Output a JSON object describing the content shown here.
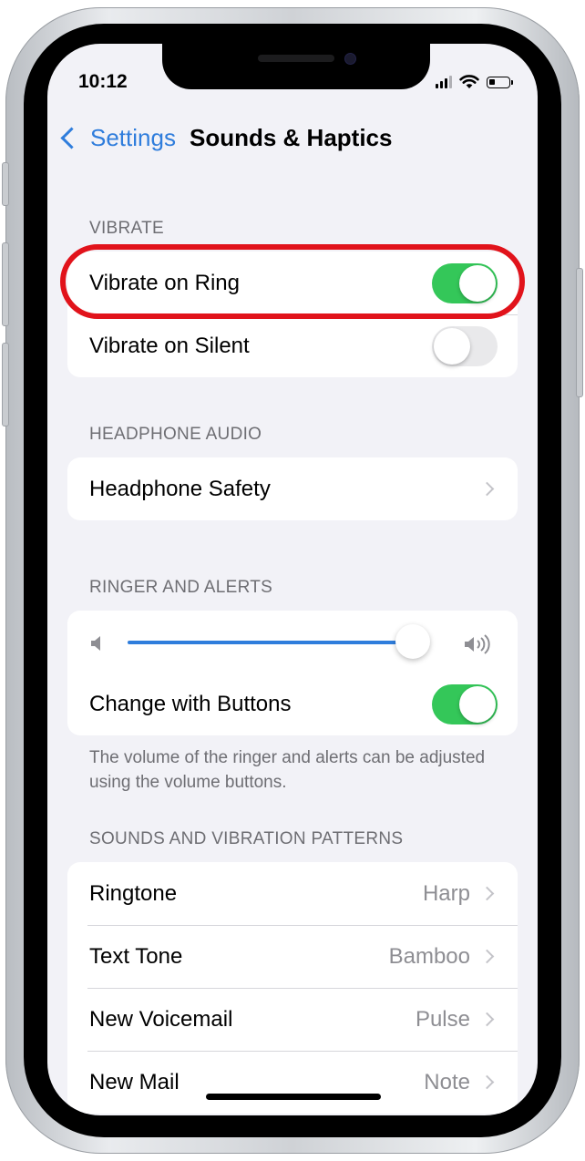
{
  "status_bar": {
    "time": "10:12"
  },
  "nav": {
    "back_label": "Settings",
    "title": "Sounds & Haptics"
  },
  "vibrate": {
    "header": "VIBRATE",
    "rows": [
      {
        "label": "Vibrate on Ring",
        "toggle": "on"
      },
      {
        "label": "Vibrate on Silent",
        "toggle": "off"
      }
    ]
  },
  "headphone_audio": {
    "header": "HEADPHONE AUDIO",
    "rows": [
      {
        "label": "Headphone Safety"
      }
    ]
  },
  "ringer": {
    "header": "RINGER AND ALERTS",
    "volume_level": 0.9,
    "change_with_buttons": {
      "label": "Change with Buttons",
      "toggle": "on"
    },
    "note": "The volume of the ringer and alerts can be adjusted using the volume buttons."
  },
  "sounds_patterns": {
    "header": "SOUNDS AND VIBRATION PATTERNS",
    "rows": [
      {
        "label": "Ringtone",
        "value": "Harp"
      },
      {
        "label": "Text Tone",
        "value": "Bamboo"
      },
      {
        "label": "New Voicemail",
        "value": "Pulse"
      },
      {
        "label": "New Mail",
        "value": "Note"
      }
    ]
  },
  "colors": {
    "accent": "#2f7ddc",
    "toggle_on": "#34c759",
    "highlight_ring": "#e1131b",
    "background": "#f2f2f7"
  },
  "icons": [
    "back-chevron-icon",
    "signal-icon",
    "wifi-icon",
    "battery-icon",
    "speaker-low-icon",
    "speaker-high-icon",
    "chevron-right-icon"
  ]
}
